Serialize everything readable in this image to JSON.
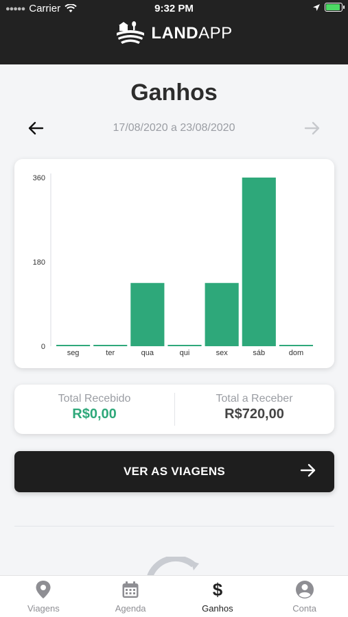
{
  "status_bar": {
    "carrier": "Carrier",
    "time": "9:32 PM"
  },
  "brand": {
    "name_bold": "LAND",
    "name_light": "APP"
  },
  "header": {
    "title": "Ganhos"
  },
  "date_nav": {
    "range": "17/08/2020 a 23/08/2020"
  },
  "chart_data": {
    "type": "bar",
    "categories": [
      "seg",
      "ter",
      "qua",
      "qui",
      "sex",
      "sáb",
      "dom"
    ],
    "values": [
      0,
      0,
      135,
      0,
      135,
      360,
      0
    ],
    "yticks": [
      "0",
      "180",
      "360"
    ],
    "ylim": [
      0,
      360
    ],
    "bar_color": "#2ea87a"
  },
  "totals": {
    "received_label": "Total Recebido",
    "received_value": "R$0,00",
    "to_receive_label": "Total a Receber",
    "to_receive_value": "R$720,00"
  },
  "cta": {
    "label": "VER AS VIAGENS"
  },
  "tabs": [
    {
      "label": "Viagens",
      "icon": "map-pin-icon"
    },
    {
      "label": "Agenda",
      "icon": "calendar-icon"
    },
    {
      "label": "Ganhos",
      "icon": "dollar-icon"
    },
    {
      "label": "Conta",
      "icon": "user-icon"
    }
  ],
  "colors": {
    "accent": "#2ea87a",
    "dark": "#222222"
  }
}
